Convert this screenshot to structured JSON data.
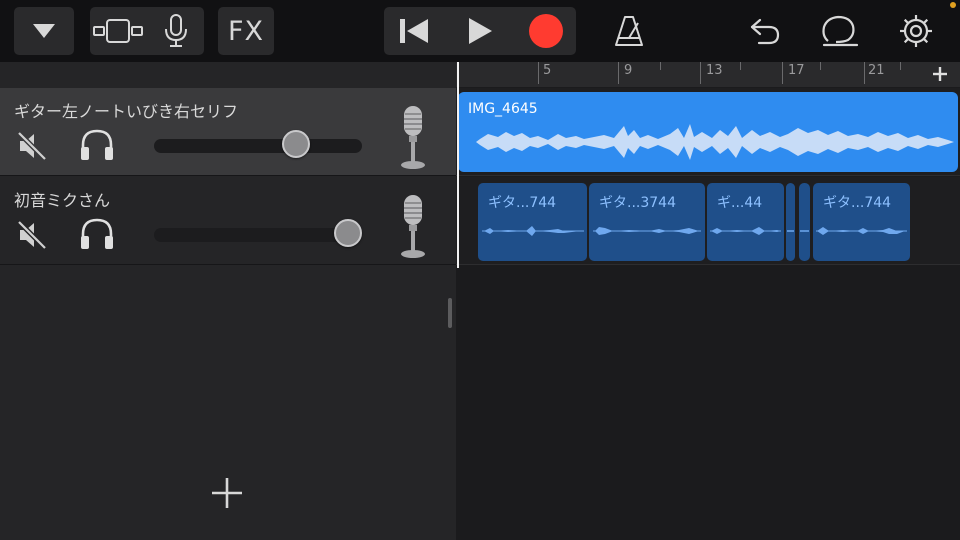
{
  "toolbar": {
    "fx_label": "FX",
    "icons": [
      "dropdown-icon",
      "track-view-icon",
      "mic-icon",
      "rewind-icon",
      "play-icon",
      "record-icon",
      "metronome-icon",
      "undo-icon",
      "loop-icon",
      "settings-icon"
    ],
    "record_color": "#ff3b30"
  },
  "ruler": {
    "labels": [
      "5",
      "9",
      "13",
      "17",
      "21"
    ],
    "add_icon": "plus-icon"
  },
  "tracks": [
    {
      "name": "ギター左ノートいびき右セリフ",
      "selected": true,
      "muted": true,
      "volume": 0.68,
      "instrument_icon": "microphone-icon"
    },
    {
      "name": "初音ミクさん",
      "selected": false,
      "muted": true,
      "volume": 0.93,
      "instrument_icon": "microphone-icon"
    }
  ],
  "regions": {
    "main": {
      "title": "IMG_4645",
      "color": "#2f8cf0"
    },
    "small": [
      {
        "title": "ギタ...744"
      },
      {
        "title": "ギタ...3744"
      },
      {
        "title": "ギ...44"
      },
      {
        "title": ""
      },
      {
        "title": ""
      },
      {
        "title": "ギタ...744"
      }
    ],
    "small_color": "#1f4f8a"
  },
  "add_track_icon": "plus-icon"
}
